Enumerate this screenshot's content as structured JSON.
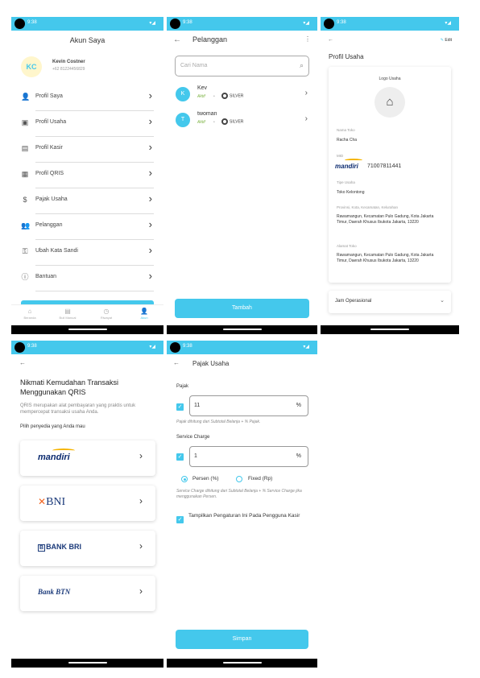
{
  "status_bar": {
    "time": "9:38",
    "icons": "⚙ ▮",
    "signal": "▾◢"
  },
  "screen1": {
    "title": "Akun Saya",
    "avatar_initials": "KC",
    "user_name": "Kevin Costner",
    "user_phone": "+62 81224456829",
    "menu": [
      {
        "label": "Profil Saya",
        "icon": "person-icon"
      },
      {
        "label": "Profil Usaha",
        "icon": "store-icon"
      },
      {
        "label": "Profil Kasir",
        "icon": "cashier-icon"
      },
      {
        "label": "Profil QRIS",
        "icon": "qr-icon"
      },
      {
        "label": "Pajak Usaha",
        "icon": "tax-icon"
      },
      {
        "label": "Pelanggan",
        "icon": "people-icon"
      },
      {
        "label": "Ubah Kata Sandi",
        "icon": "key-icon"
      },
      {
        "label": "Bantuan",
        "icon": "info-icon"
      }
    ],
    "bottom_nav": [
      "Beranda",
      "Buli Manual",
      "Riwayat",
      "Akun"
    ]
  },
  "screen2": {
    "title": "Pelanggan",
    "search_placeholder": "Cari Nama",
    "customers": [
      {
        "initial": "K",
        "name": "Kev",
        "status": "Aktif",
        "tier": "SILVER"
      },
      {
        "initial": "T",
        "name": "twoman",
        "status": "Aktif",
        "tier": "SILVER"
      }
    ],
    "add_button": "Tambah"
  },
  "screen3": {
    "edit_label": "Edit",
    "title": "Profil Usaha",
    "logo_label": "Logo Usaha",
    "fields": {
      "store_name_label": "Nama Toko",
      "store_name": "Racha Cha",
      "mid_label": "MID",
      "mid_bank": "mandiri",
      "mid_value": "71007811441",
      "type_label": "Tipe Usaha",
      "type_value": "Toko Kelontong",
      "region_label": "Provinsi, Kota, Kecamatan, Kelurahan",
      "region_value": "Rawamangun, Kecamatan Pulo Gadung, Kota Jakarta Timur, Daerah Khusus Ibukota Jakarta, 13220",
      "address_label": "Alamat Toko",
      "address_value": "Rawamangun, Kecamatan Pulo Gadung, Kota Jakarta Timur, Daerah Khusus Ibukota Jakarta, 13220"
    },
    "hours_label": "Jam Operasional"
  },
  "screen4": {
    "heading": "Nikmati Kemudahan Transaksi Menggunakan QRIS",
    "description": "QRIS merupakan alat pembayaran yang praktis untuk mempercepat transaksi usaha Anda.",
    "choose_label": "Pilih penyedia yang Anda mau",
    "banks": [
      "mandiri",
      "BNI",
      "BANK BRI",
      "Bank BTN"
    ]
  },
  "screen5": {
    "title": "Pajak Usaha",
    "tax_label": "Pajak",
    "tax_value": "11",
    "tax_unit": "%",
    "tax_note": "Pajak dihitung dari Subtotal Belanja + % Pajak.",
    "service_label": "Service Charge",
    "service_value": "1",
    "service_unit": "%",
    "option_percent": "Persen (%)",
    "option_fixed": "Fixed (Rp)",
    "service_note": "Service Charge dihitung dari Subtotal Belanja + % Service Charge jika menggunakan Persen.",
    "show_setting_label": "Tampilkan Pengaturan Ini Pada Pengguna Kasir",
    "save_button": "Simpan"
  },
  "colors": {
    "accent": "#44c8ec",
    "active_status": "#7cb342"
  }
}
